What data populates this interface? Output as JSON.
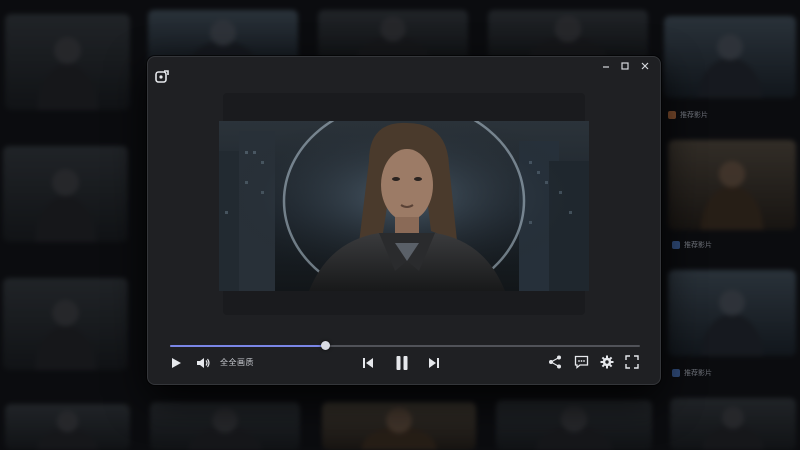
{
  "player": {
    "progress_fraction": 0.33,
    "quality_label": "全全画质",
    "icons": {
      "app": "app-logo-icon",
      "minimize": "minimize-icon",
      "maximize": "maximize-icon",
      "close": "close-icon",
      "play": "play-icon",
      "volume": "volume-icon",
      "previous": "skip-previous-icon",
      "pause": "pause-icon",
      "next": "skip-next-icon",
      "share": "share-icon",
      "subtitles": "subtitles-icon",
      "settings": "gear-icon",
      "fullscreen": "fullscreen-icon"
    }
  },
  "colors": {
    "accent": "#7a86e6",
    "window_bg": "#1f2023",
    "video_bg": "#1a1b1e",
    "icon": "#e6e8ec"
  },
  "background_captions": [
    {
      "text": "推荐影片",
      "accent": "#7a4a2c"
    },
    {
      "text": "推荐影片",
      "accent": "#2f4a78"
    },
    {
      "text": "推荐影片",
      "accent": "#2f4a78"
    }
  ]
}
